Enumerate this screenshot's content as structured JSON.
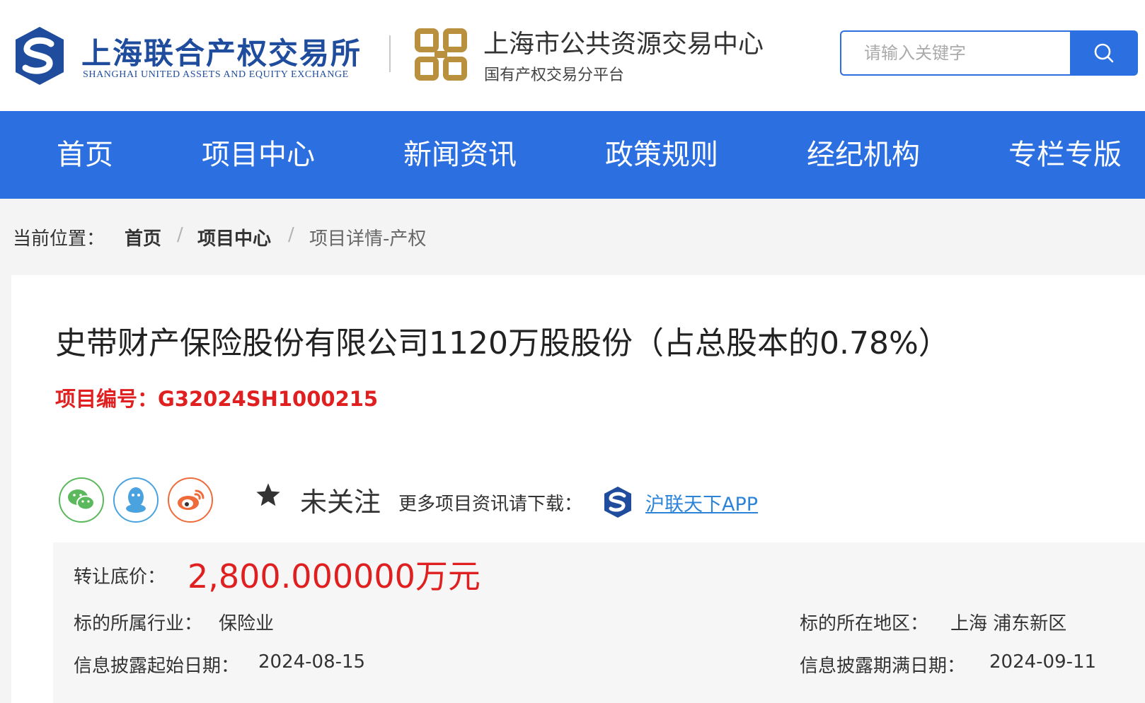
{
  "header": {
    "brand_cn": "上海联合产权交易所",
    "brand_en": "SHANGHAI UNITED ASSETS AND EQUITY EXCHANGE",
    "public_title": "上海市公共资源交易中心",
    "public_subtitle": "国有产权交易分平台",
    "search": {
      "placeholder": "请输入关键字",
      "value": ""
    },
    "brand_color": "#1f4c9c",
    "gold_color": "#b8903e"
  },
  "nav": {
    "color": "#2c6fe0",
    "items": [
      {
        "label": "首页"
      },
      {
        "label": "项目中心"
      },
      {
        "label": "新闻资讯"
      },
      {
        "label": "政策规则"
      },
      {
        "label": "经纪机构"
      },
      {
        "label": "专栏专版"
      }
    ]
  },
  "breadcrumb": {
    "label": "当前位置：",
    "items": [
      "首页",
      "项目中心",
      "项目详情-产权"
    ],
    "separator": "/"
  },
  "project": {
    "title": "史带财产保险股份有限公司1120万股股份（占总股本的0.78%）",
    "code_label": "项目编号：",
    "code": "G32024SH1000215",
    "follow_status": "未关注",
    "download_prompt": "更多项目资讯请下载：",
    "app_link": "沪联天下APP",
    "share_icons": [
      "wechat-icon",
      "qq-icon",
      "weibo-icon"
    ]
  },
  "details": {
    "price_label": "转让底价：",
    "price": "2,800.000000万元",
    "industry_label": "标的所属行业：",
    "industry": "保险业",
    "region_label": "标的所在地区：",
    "region": "上海 浦东新区",
    "start_label": "信息披露起始日期：",
    "start_date": "2024-08-15",
    "end_label": "信息披露期满日期：",
    "end_date": "2024-09-11"
  },
  "colors": {
    "accent_red": "#e02020",
    "link_blue": "#2c84d8"
  }
}
